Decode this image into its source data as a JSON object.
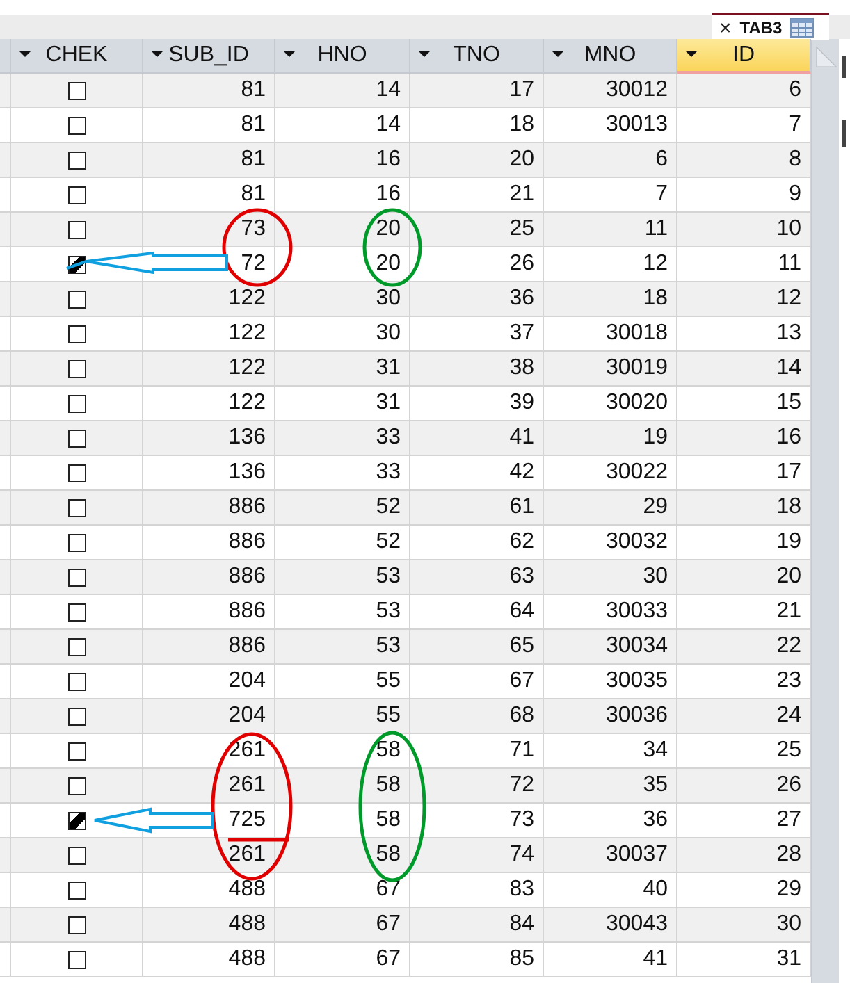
{
  "document_tab": {
    "close": "×",
    "title": "TAB3",
    "selected": true
  },
  "columns": [
    {
      "label": "CHEK",
      "selected": false
    },
    {
      "label": "SUB_ID",
      "selected": false
    },
    {
      "label": "HNO",
      "selected": false
    },
    {
      "label": "TNO",
      "selected": false
    },
    {
      "label": "MNO",
      "selected": false
    },
    {
      "label": "ID",
      "selected": true
    }
  ],
  "rows": [
    {
      "chek": false,
      "sub_id": "81",
      "hno": "14",
      "tno": "17",
      "mno": "30012",
      "id": "6"
    },
    {
      "chek": false,
      "sub_id": "81",
      "hno": "14",
      "tno": "18",
      "mno": "30013",
      "id": "7"
    },
    {
      "chek": false,
      "sub_id": "81",
      "hno": "16",
      "tno": "20",
      "mno": "6",
      "id": "8"
    },
    {
      "chek": false,
      "sub_id": "81",
      "hno": "16",
      "tno": "21",
      "mno": "7",
      "id": "9"
    },
    {
      "chek": false,
      "sub_id": "73",
      "hno": "20",
      "tno": "25",
      "mno": "11",
      "id": "10"
    },
    {
      "chek": true,
      "sub_id": "72",
      "hno": "20",
      "tno": "26",
      "mno": "12",
      "id": "11"
    },
    {
      "chek": false,
      "sub_id": "122",
      "hno": "30",
      "tno": "36",
      "mno": "18",
      "id": "12"
    },
    {
      "chek": false,
      "sub_id": "122",
      "hno": "30",
      "tno": "37",
      "mno": "30018",
      "id": "13"
    },
    {
      "chek": false,
      "sub_id": "122",
      "hno": "31",
      "tno": "38",
      "mno": "30019",
      "id": "14"
    },
    {
      "chek": false,
      "sub_id": "122",
      "hno": "31",
      "tno": "39",
      "mno": "30020",
      "id": "15"
    },
    {
      "chek": false,
      "sub_id": "136",
      "hno": "33",
      "tno": "41",
      "mno": "19",
      "id": "16"
    },
    {
      "chek": false,
      "sub_id": "136",
      "hno": "33",
      "tno": "42",
      "mno": "30022",
      "id": "17"
    },
    {
      "chek": false,
      "sub_id": "886",
      "hno": "52",
      "tno": "61",
      "mno": "29",
      "id": "18"
    },
    {
      "chek": false,
      "sub_id": "886",
      "hno": "52",
      "tno": "62",
      "mno": "30032",
      "id": "19"
    },
    {
      "chek": false,
      "sub_id": "886",
      "hno": "53",
      "tno": "63",
      "mno": "30",
      "id": "20"
    },
    {
      "chek": false,
      "sub_id": "886",
      "hno": "53",
      "tno": "64",
      "mno": "30033",
      "id": "21"
    },
    {
      "chek": false,
      "sub_id": "886",
      "hno": "53",
      "tno": "65",
      "mno": "30034",
      "id": "22"
    },
    {
      "chek": false,
      "sub_id": "204",
      "hno": "55",
      "tno": "67",
      "mno": "30035",
      "id": "23"
    },
    {
      "chek": false,
      "sub_id": "204",
      "hno": "55",
      "tno": "68",
      "mno": "30036",
      "id": "24"
    },
    {
      "chek": false,
      "sub_id": "261",
      "hno": "58",
      "tno": "71",
      "mno": "34",
      "id": "25"
    },
    {
      "chek": false,
      "sub_id": "261",
      "hno": "58",
      "tno": "72",
      "mno": "35",
      "id": "26"
    },
    {
      "chek": true,
      "sub_id": "725",
      "hno": "58",
      "tno": "73",
      "mno": "36",
      "id": "27"
    },
    {
      "chek": false,
      "sub_id": "261",
      "hno": "58",
      "tno": "74",
      "mno": "30037",
      "id": "28"
    },
    {
      "chek": false,
      "sub_id": "488",
      "hno": "67",
      "tno": "83",
      "mno": "40",
      "id": "29"
    },
    {
      "chek": false,
      "sub_id": "488",
      "hno": "67",
      "tno": "84",
      "mno": "30043",
      "id": "30"
    },
    {
      "chek": false,
      "sub_id": "488",
      "hno": "67",
      "tno": "85",
      "mno": "41",
      "id": "31"
    }
  ]
}
